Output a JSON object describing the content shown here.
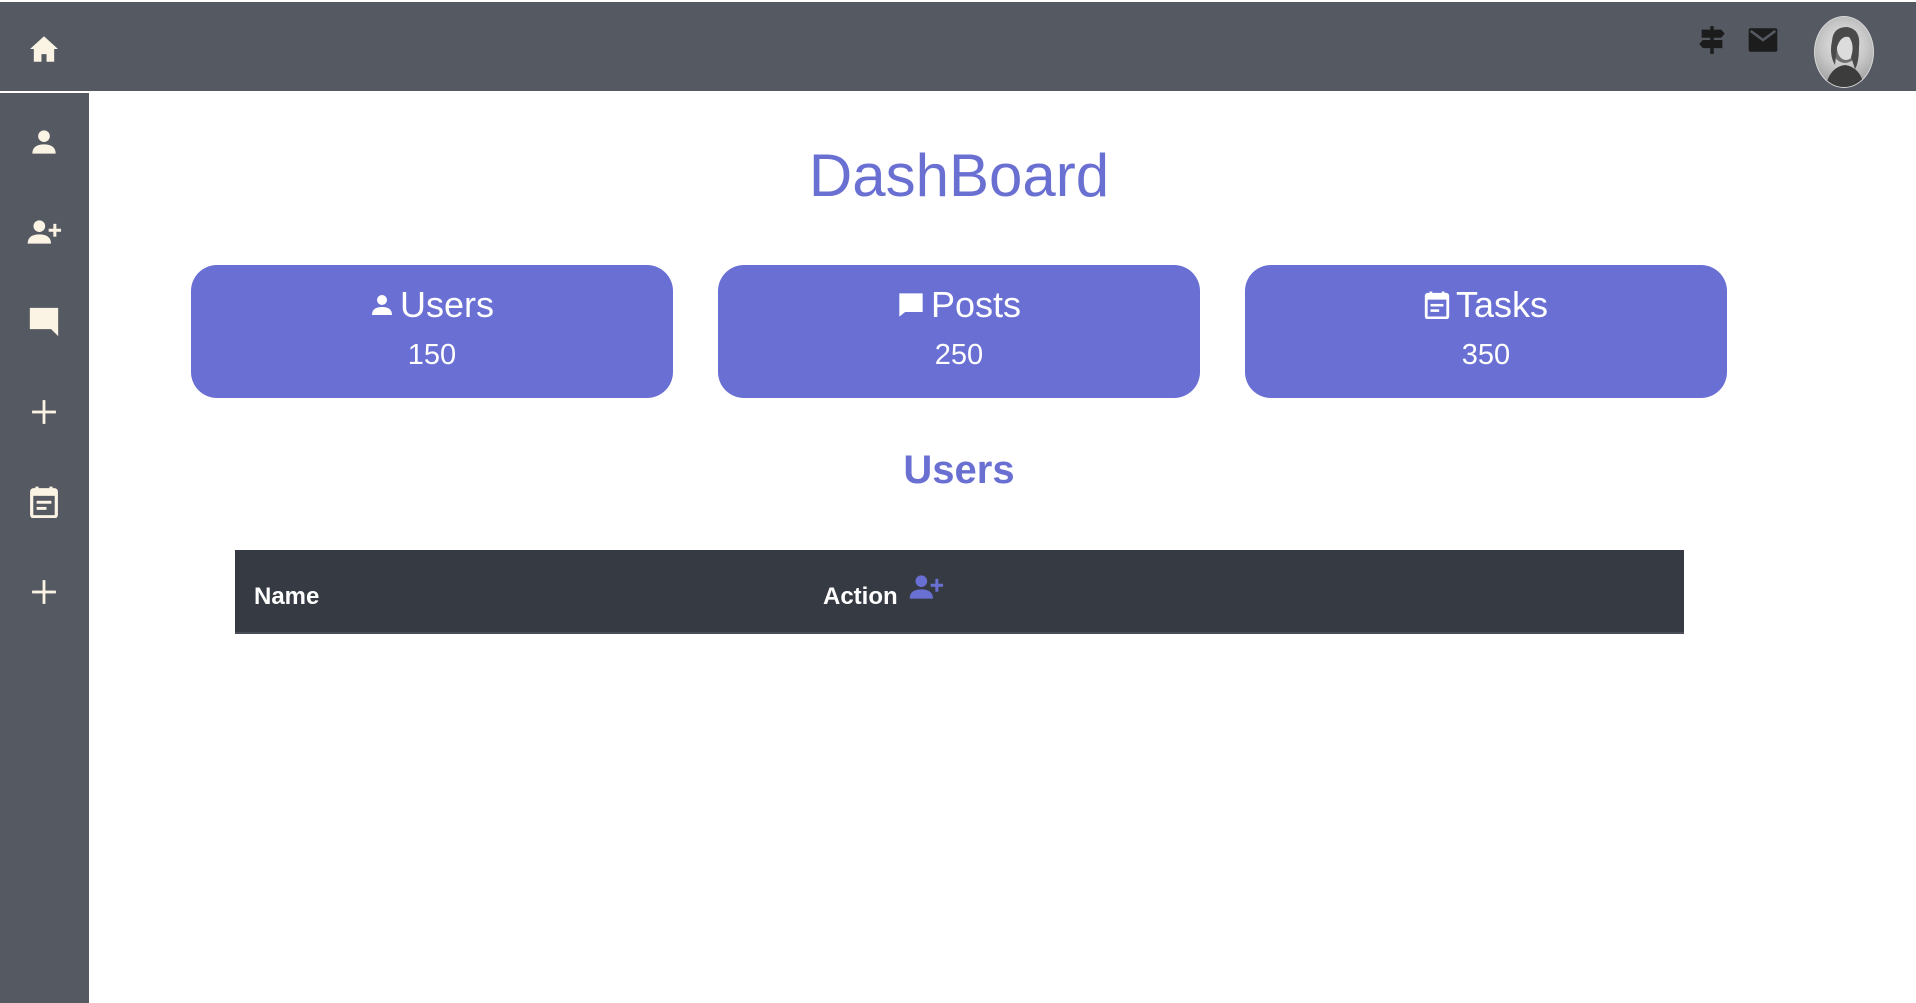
{
  "topbar": {
    "home_icon": "home-icon",
    "icons": [
      "signpost-icon",
      "mail-icon"
    ],
    "avatar": "user-avatar"
  },
  "sidebar": {
    "items": [
      {
        "icon": "person-icon"
      },
      {
        "icon": "person-add-icon"
      },
      {
        "icon": "comment-icon"
      },
      {
        "icon": "plus-icon"
      },
      {
        "icon": "event-note-icon"
      },
      {
        "icon": "plus-icon"
      }
    ]
  },
  "page": {
    "title": "DashBoard"
  },
  "cards": [
    {
      "label": "Users",
      "value": "150",
      "icon": "person-icon"
    },
    {
      "label": "Posts",
      "value": "250",
      "icon": "comment-icon"
    },
    {
      "label": "Tasks",
      "value": "350",
      "icon": "event-note-icon"
    }
  ],
  "users_section": {
    "title": "Users",
    "columns": [
      "Name",
      "Action"
    ],
    "add_icon": "person-add-icon"
  },
  "colors": {
    "accent": "#6a70d3",
    "chrome": "#545962",
    "table_header": "#353a43",
    "icon_cream": "#fbf3e4"
  }
}
